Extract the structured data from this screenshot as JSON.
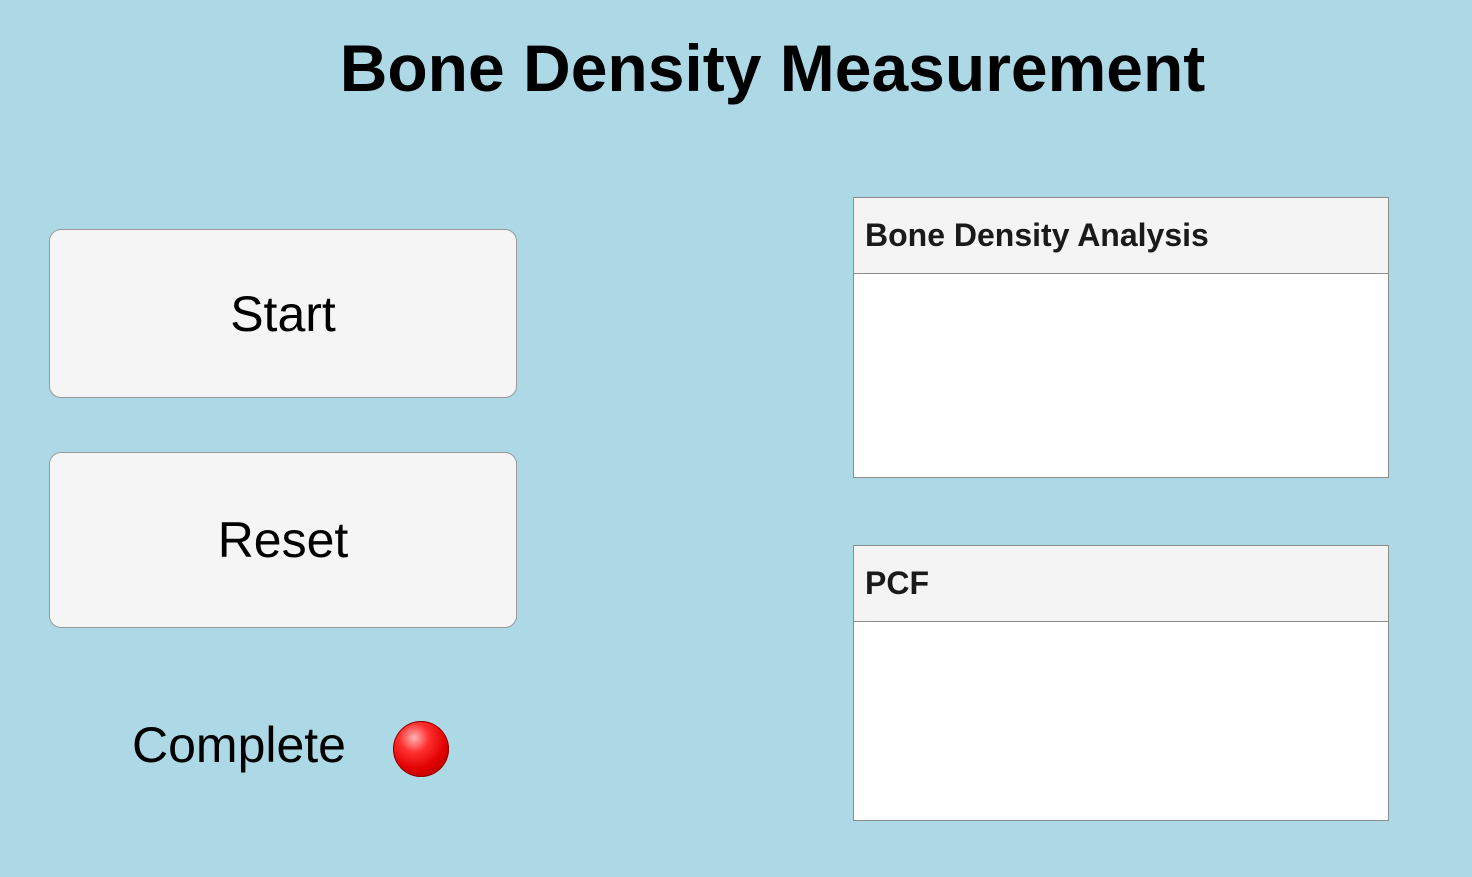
{
  "app": {
    "title": "Bone Density Measurement"
  },
  "buttons": {
    "start_label": "Start",
    "reset_label": "Reset"
  },
  "status": {
    "lamp_label": "Complete",
    "lamp_color": "#e00000"
  },
  "panels": [
    {
      "title": "Bone Density Analysis"
    },
    {
      "title": "PCF"
    }
  ],
  "colors": {
    "background": "#add8e6",
    "button_bg": "#f5f5f5",
    "panel_header_bg": "#f4f4f4"
  }
}
